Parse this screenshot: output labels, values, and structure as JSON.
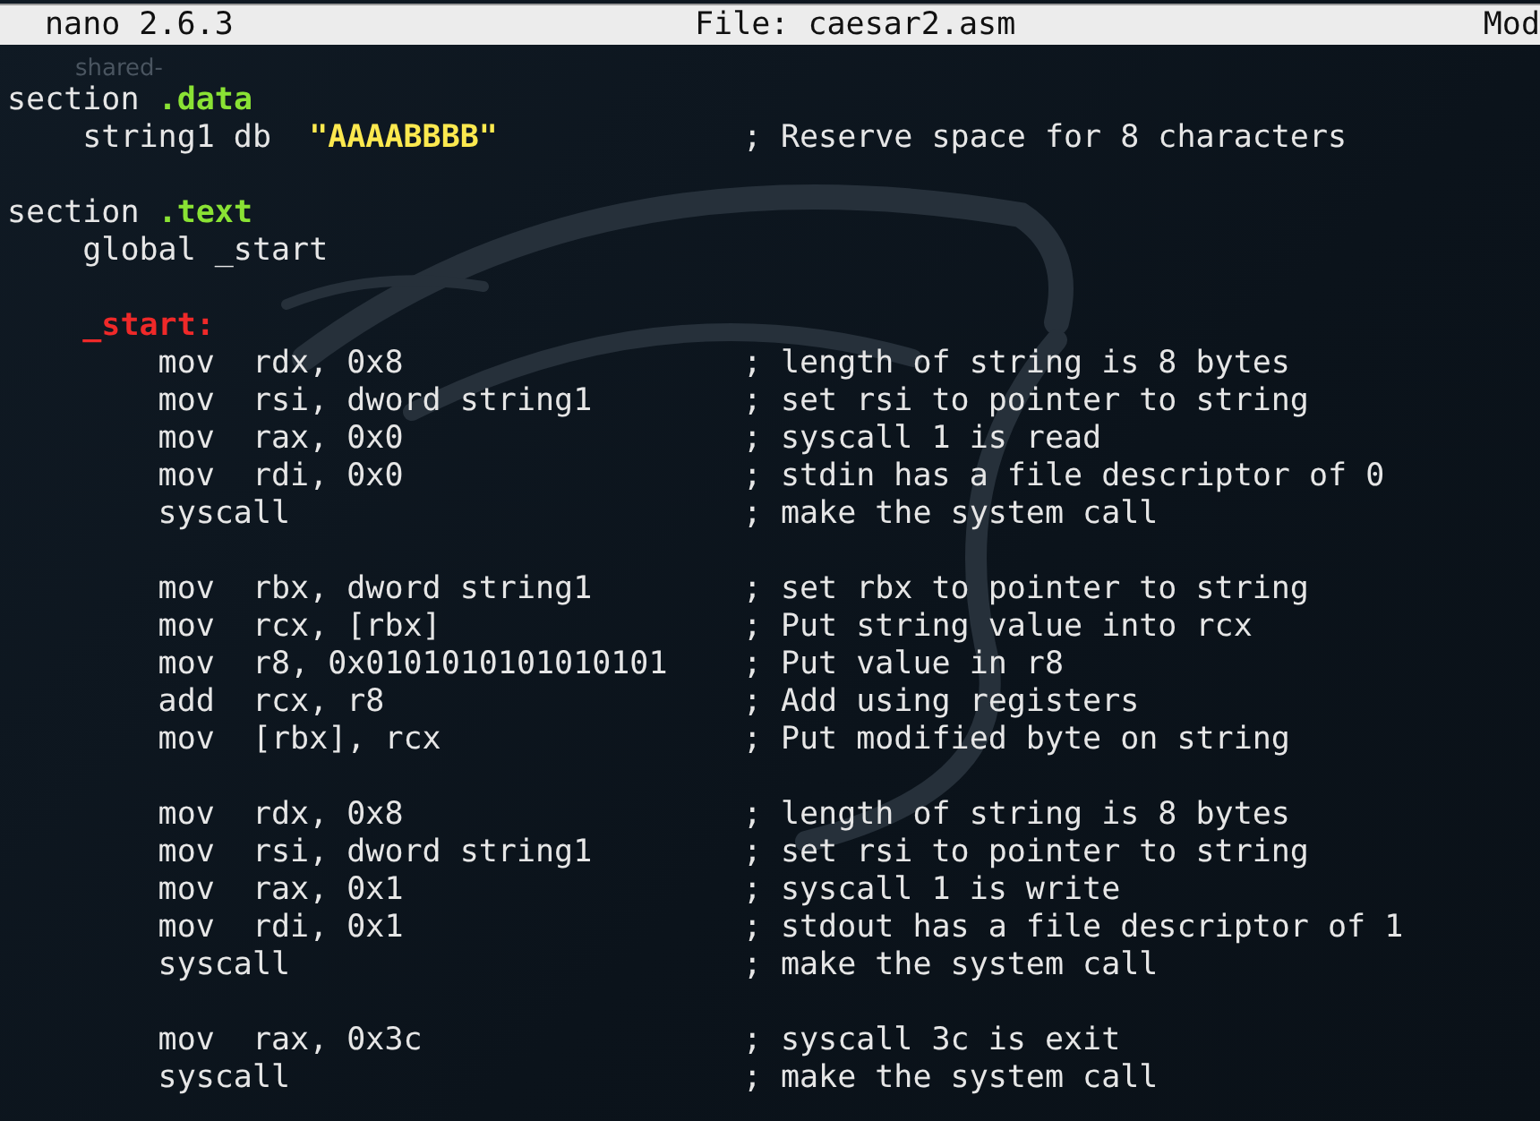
{
  "title_bar": {
    "version": "nano 2.6.3",
    "file": "File: caesar2.asm",
    "status": "Mod"
  },
  "desktop_icon_label": "shared-",
  "lines": [
    {
      "kind": "section",
      "text": "section",
      "name": ".data",
      "children": [
        {
          "kind": "directive",
          "text": "string1 db",
          "value": "\"AAAABBBB\"",
          "comment": "; Reserve space for 8 characters"
        },
        {
          "kind": "blank"
        }
      ]
    },
    {
      "kind": "section",
      "text": "section",
      "name": ".text",
      "children": [
        {
          "kind": "instruction",
          "text": "global _start"
        },
        {
          "kind": "blank"
        },
        {
          "kind": "label",
          "text": "_start:",
          "children": [
            {
              "kind": "instruction",
              "text": "mov  rdx, 0x8",
              "comment": "; length of string is 8 bytes"
            },
            {
              "kind": "instruction",
              "text": "mov  rsi, dword string1",
              "comment": "; set rsi to pointer to string"
            },
            {
              "kind": "instruction",
              "text": "mov  rax, 0x0",
              "comment": "; syscall 1 is read"
            },
            {
              "kind": "instruction",
              "text": "mov  rdi, 0x0",
              "comment": "; stdin has a file descriptor of 0"
            },
            {
              "kind": "instruction",
              "text": "syscall",
              "comment": "; make the system call"
            },
            {
              "kind": "blank"
            },
            {
              "kind": "instruction",
              "text": "mov  rbx, dword string1",
              "comment": "; set rbx to pointer to string"
            },
            {
              "kind": "instruction",
              "text": "mov  rcx, [rbx]",
              "comment": "; Put string value into rcx"
            },
            {
              "kind": "instruction",
              "text": "mov  r8, 0x0101010101010101",
              "comment": "; Put value in r8"
            },
            {
              "kind": "instruction",
              "text": "add  rcx, r8",
              "comment": "; Add using registers"
            },
            {
              "kind": "instruction",
              "text": "mov  [rbx], rcx",
              "comment": "; Put modified byte on string"
            },
            {
              "kind": "blank"
            },
            {
              "kind": "instruction",
              "text": "mov  rdx, 0x8",
              "comment": "; length of string is 8 bytes"
            },
            {
              "kind": "instruction",
              "text": "mov  rsi, dword string1",
              "comment": "; set rsi to pointer to string"
            },
            {
              "kind": "instruction",
              "text": "mov  rax, 0x1",
              "comment": "; syscall 1 is write"
            },
            {
              "kind": "instruction",
              "text": "mov  rdi, 0x1",
              "comment": "; stdout has a file descriptor of 1"
            },
            {
              "kind": "instruction",
              "text": "syscall",
              "comment": "; make the system call"
            },
            {
              "kind": "blank"
            },
            {
              "kind": "instruction",
              "text": "mov  rax, 0x3c",
              "comment": "; syscall 3c is exit"
            },
            {
              "kind": "instruction",
              "text": "syscall",
              "comment": "; make the system call"
            }
          ]
        }
      ]
    }
  ]
}
